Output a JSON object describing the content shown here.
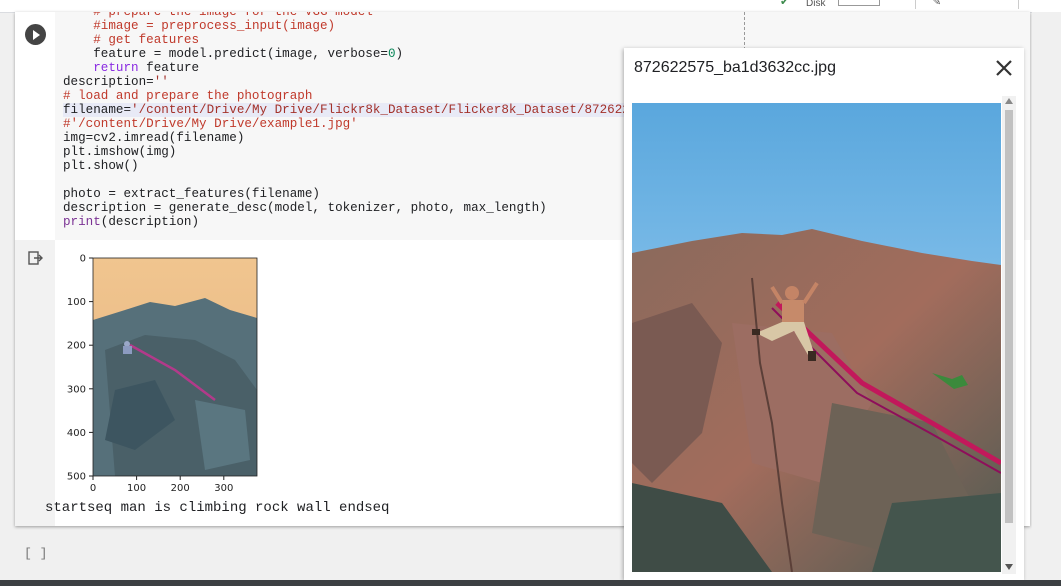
{
  "topbar": {
    "disk_label": "Disk"
  },
  "code_cell": {
    "lines": [
      {
        "indent": "    ",
        "parts": [
          {
            "t": "# prepare the image for the VGG model",
            "c": "c-com"
          }
        ]
      },
      {
        "indent": "    ",
        "parts": [
          {
            "t": "#image = preprocess_input(image)",
            "c": "c-com"
          }
        ]
      },
      {
        "indent": "    ",
        "parts": [
          {
            "t": "# get features",
            "c": "c-com"
          }
        ]
      },
      {
        "indent": "    ",
        "parts": [
          {
            "t": "feature = model.predict(image, verbose=",
            "c": ""
          },
          {
            "t": "0",
            "c": "c-num"
          },
          {
            "t": ")",
            "c": ""
          }
        ]
      },
      {
        "indent": "    ",
        "parts": [
          {
            "t": "return",
            "c": "c-kw"
          },
          {
            "t": " feature",
            "c": ""
          }
        ]
      },
      {
        "indent": "",
        "parts": [
          {
            "t": "description=",
            "c": ""
          },
          {
            "t": "''",
            "c": "c-str"
          }
        ]
      },
      {
        "indent": "",
        "parts": [
          {
            "t": "# load and prepare the photograph",
            "c": "c-com"
          }
        ]
      },
      {
        "indent": "",
        "hl": true,
        "parts": [
          {
            "t": "filename=",
            "c": ""
          },
          {
            "t": "'/content/Drive/My Drive/Flickr8k_Dataset/Flicker8k_Dataset/872622575_ba1d3632cc.jpg'",
            "c": "c-str"
          }
        ]
      },
      {
        "indent": "",
        "parts": [
          {
            "t": "#'/content/Drive/My Drive/example1.jpg'",
            "c": "c-com"
          }
        ]
      },
      {
        "indent": "",
        "parts": [
          {
            "t": "img=cv2.imread(filename)",
            "c": ""
          }
        ]
      },
      {
        "indent": "",
        "parts": [
          {
            "t": "plt.imshow(img)",
            "c": ""
          }
        ]
      },
      {
        "indent": "",
        "parts": [
          {
            "t": "plt.show()",
            "c": ""
          }
        ]
      },
      {
        "indent": "",
        "parts": [
          {
            "t": "",
            "c": ""
          }
        ]
      },
      {
        "indent": "",
        "parts": [
          {
            "t": "photo = extract_features(filename)",
            "c": ""
          }
        ]
      },
      {
        "indent": "",
        "parts": [
          {
            "t": "description = generate_desc(model, tokenizer, photo, max_length)",
            "c": ""
          }
        ]
      },
      {
        "indent": "",
        "parts": [
          {
            "t": "print",
            "c": "c-fn"
          },
          {
            "t": "(description)",
            "c": ""
          }
        ]
      }
    ]
  },
  "output": {
    "stdout": "startseq man is climbing rock wall endseq",
    "plot": {
      "y_ticks": [
        "0",
        "100",
        "200",
        "300",
        "400",
        "500"
      ],
      "x_ticks": [
        "0",
        "100",
        "200",
        "300"
      ]
    }
  },
  "empty_cell": {
    "prompt": "[ ]"
  },
  "image_viewer": {
    "filename": "872622575_ba1d3632cc.jpg"
  },
  "colors": {
    "run_button": "#444444",
    "rope": "#c2185b",
    "sky": "#7fbde6"
  },
  "icons": {
    "run": "play-circle-icon",
    "output": "output-redirect-icon",
    "close": "close-icon"
  }
}
